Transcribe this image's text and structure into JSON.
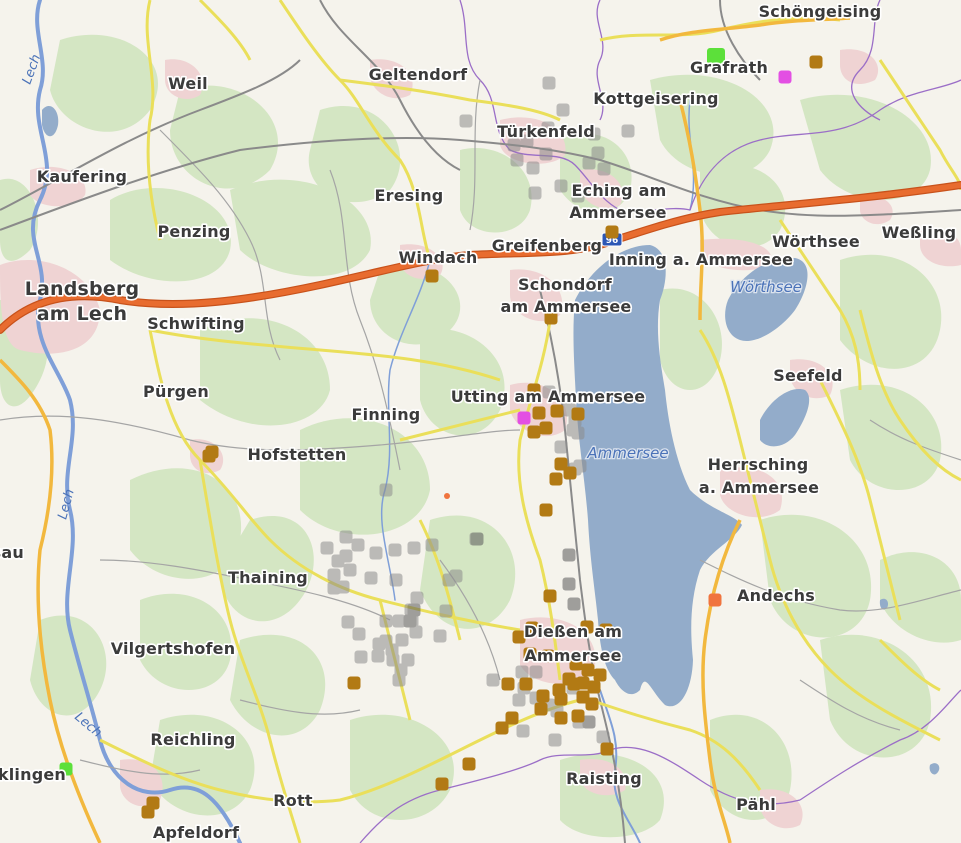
{
  "map": {
    "places": [
      {
        "name": "Schöngeising"
      },
      {
        "name": "Weil"
      },
      {
        "name": "Geltendorf"
      },
      {
        "name": "Grafrath"
      },
      {
        "name": "Kottgeisering"
      },
      {
        "name": "Türkenfeld"
      },
      {
        "name": "Kaufering"
      },
      {
        "name": "Eresing"
      },
      {
        "name": "Eching am"
      },
      {
        "name": "Ammersee"
      },
      {
        "name": "Penzing"
      },
      {
        "name": "Greifenberg"
      },
      {
        "name": "Wörthsee"
      },
      {
        "name": "Weßling"
      },
      {
        "name": "Windach"
      },
      {
        "name": "Inning a. Ammersee"
      },
      {
        "name": "Schondorf"
      },
      {
        "name": "am Ammersee"
      },
      {
        "name": "Landsberg"
      },
      {
        "name": "am Lech"
      },
      {
        "name": "Schwifting"
      },
      {
        "name": "Seefeld"
      },
      {
        "name": "Pürgen"
      },
      {
        "name": "Utting am Ammersee"
      },
      {
        "name": "Finning"
      },
      {
        "name": "Hofstetten"
      },
      {
        "name": "Herrsching"
      },
      {
        "name": "a. Ammersee"
      },
      {
        "name": "Thaining"
      },
      {
        "name": "Andechs"
      },
      {
        "name": "Dießen am"
      },
      {
        "name": "Ammersee"
      },
      {
        "name": "Vilgertshofen"
      },
      {
        "name": "Reichling"
      },
      {
        "name": "Raisting"
      },
      {
        "name": "Rott"
      },
      {
        "name": "Pähl"
      },
      {
        "name": "Apfeldorf"
      },
      {
        "name": "Kinsau"
      },
      {
        "name": "Denklingen"
      }
    ],
    "water_labels": [
      {
        "name": "Wörthsee"
      },
      {
        "name": "Ammersee"
      }
    ],
    "river_labels": [
      {
        "name": "Lech"
      },
      {
        "name": "Lech"
      },
      {
        "name": "Lech"
      }
    ],
    "road_shields": [
      {
        "label": "96"
      }
    ],
    "colors": {
      "background": "#f5f3ec",
      "forest": "#d4e6c3",
      "settlement": "#efd3d3",
      "lake": "#93acca",
      "motorway": "#e86c2f",
      "primary_road": "#f2b83e",
      "secondary_road": "#eadf5a",
      "minor_road": "#a5a5a5",
      "railway": "#8a8a8a",
      "boundary": "#9b6ec7",
      "river": "#7f9fd8",
      "marker_brown": "#b27a14",
      "marker_grey": "#8c8c8c",
      "marker_darkgrey": "#5a5a5a",
      "marker_magenta": "#e34fe3",
      "marker_orange": "#f0743e",
      "marker_green": "#5ce03a"
    }
  }
}
